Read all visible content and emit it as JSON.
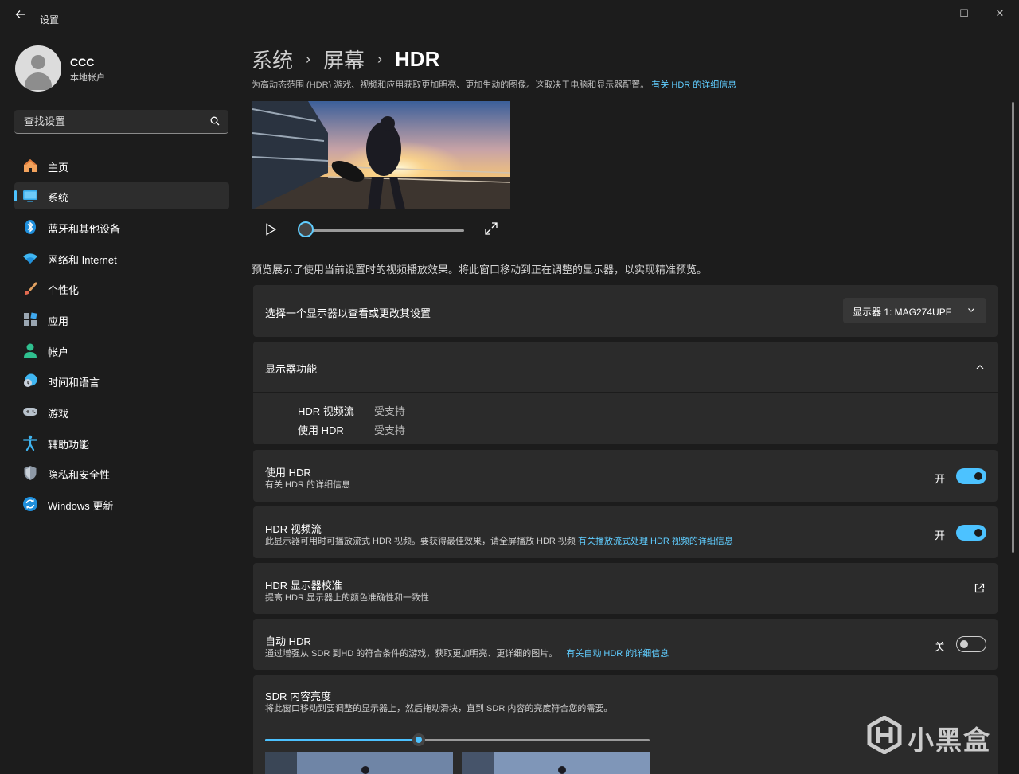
{
  "window": {
    "title": "设置",
    "back_icon": "back-arrow-icon",
    "minimize_glyph": "—",
    "maximize_glyph": "☐",
    "close_glyph": "✕"
  },
  "profile": {
    "name": "CCC",
    "account_type": "本地帐户"
  },
  "search": {
    "placeholder": "查找设置"
  },
  "sidebar": {
    "items": [
      {
        "label": "主页",
        "icon": "home-icon"
      },
      {
        "label": "系统",
        "icon": "system-display-icon",
        "selected": true
      },
      {
        "label": "蓝牙和其他设备",
        "icon": "bluetooth-icon"
      },
      {
        "label": "网络和 Internet",
        "icon": "wifi-icon"
      },
      {
        "label": "个性化",
        "icon": "brush-icon"
      },
      {
        "label": "应用",
        "icon": "apps-icon"
      },
      {
        "label": "帐户",
        "icon": "account-icon"
      },
      {
        "label": "时间和语言",
        "icon": "time-language-icon"
      },
      {
        "label": "游戏",
        "icon": "gamepad-icon"
      },
      {
        "label": "辅助功能",
        "icon": "accessibility-icon"
      },
      {
        "label": "隐私和安全性",
        "icon": "shield-icon"
      },
      {
        "label": "Windows 更新",
        "icon": "windows-update-icon"
      }
    ]
  },
  "breadcrumb": {
    "level1": "系统",
    "level2": "屏幕",
    "current": "HDR",
    "separator": "›"
  },
  "intro": {
    "text": "为高动态范围 (HDR) 游戏、视频和应用获取更加明亮、更加生动的图像。这取决于电脑和显示器配置。",
    "link": "有关 HDR 的详细信息"
  },
  "preview": {
    "progress": 0,
    "note": "预览展示了使用当前设置时的视频播放效果。将此窗口移动到正在调整的显示器，以实现精准预览。"
  },
  "display_select": {
    "label": "选择一个显示器以查看或更改其设置",
    "value": "显示器 1: MAG274UPF"
  },
  "capabilities": {
    "title": "显示器功能",
    "expanded": true,
    "rows": [
      {
        "name": "HDR 视频流",
        "value": "受支持"
      },
      {
        "name": "使用 HDR",
        "value": "受支持"
      }
    ]
  },
  "use_hdr": {
    "title": "使用 HDR",
    "link": "有关 HDR 的详细信息",
    "state_label": "开",
    "on": true
  },
  "hdr_streaming": {
    "title": "HDR 视频流",
    "desc": "此显示器可用时可播放流式 HDR 视频。要获得最佳效果，请全屏播放 HDR 视频",
    "link": "有关播放流式处理 HDR 视频的详细信息",
    "state_label": "开",
    "on": true
  },
  "calibration": {
    "title": "HDR 显示器校准",
    "desc": "提高 HDR 显示器上的颜色准确性和一致性"
  },
  "auto_hdr": {
    "title": "自动 HDR",
    "desc": "通过增强从 SDR 到HD 的符合条件的游戏，获取更加明亮、更详细的图片。",
    "link": "有关自动 HDR 的详细信息",
    "state_label": "关",
    "on": false
  },
  "sdr_brightness": {
    "title": "SDR 内容亮度",
    "desc": "将此窗口移动到要调整的显示器上，然后拖动滑块，直到 SDR 内容的亮度符合您的需要。",
    "level": 0.4
  },
  "watermark": {
    "text": "小黑盒"
  },
  "colors": {
    "accent": "#4cc2ff",
    "link": "#60cdff",
    "card": "#2b2b2b",
    "background": "#1c1c1c"
  }
}
